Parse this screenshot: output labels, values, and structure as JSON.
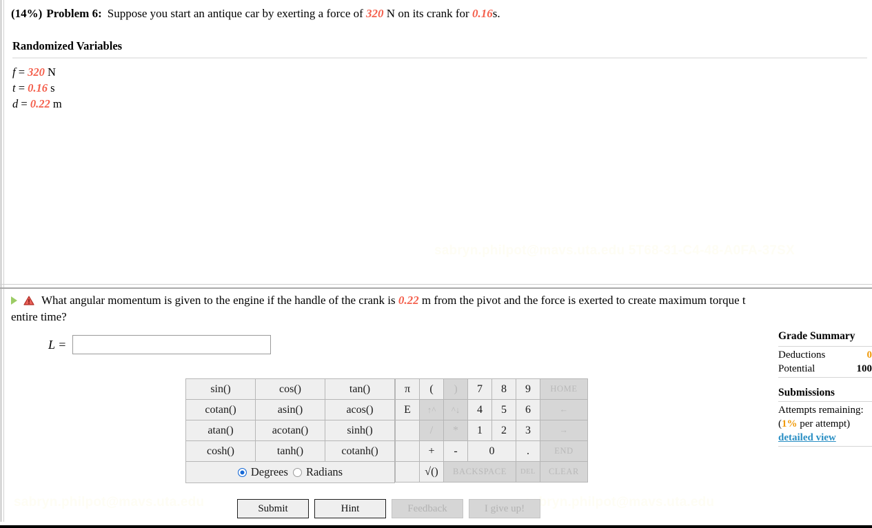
{
  "problem": {
    "percent": "(14%)",
    "number": "Problem 6:",
    "text_before_force": "Suppose you start an antique car by exerting a force of",
    "force_value": "320",
    "text_after_force": "N on its crank for",
    "time_value": "0.16",
    "text_end": "s."
  },
  "randomized_variables": {
    "title": "Randomized Variables",
    "items": [
      {
        "symbol": "f",
        "equals": "=",
        "value": "320",
        "unit": "N"
      },
      {
        "symbol": "t",
        "equals": "=",
        "value": "0.16",
        "unit": "s"
      },
      {
        "symbol": "d",
        "equals": "=",
        "value": "0.22",
        "unit": "m"
      }
    ]
  },
  "question": {
    "part1": "What angular momentum is given to the engine if the handle of the crank is",
    "distance_value": "0.22",
    "part2": "m from the pivot and the force is exerted to create maximum torque t",
    "line2": "entire time?",
    "answer_label": "L =",
    "answer_value": "",
    "answer_placeholder": ""
  },
  "calculator": {
    "trig_rows": [
      [
        "sin()",
        "cos()",
        "tan()"
      ],
      [
        "cotan()",
        "asin()",
        "acos()"
      ],
      [
        "atan()",
        "acotan()",
        "sinh()"
      ],
      [
        "cosh()",
        "tanh()",
        "cotanh()"
      ]
    ],
    "angle_mode": {
      "degrees_label": "Degrees",
      "radians_label": "Radians",
      "selected": "Degrees"
    },
    "numeric_rows": [
      [
        {
          "label": "π",
          "state": "active"
        },
        {
          "label": "(",
          "state": "active"
        },
        {
          "label": ")",
          "state": "disabled"
        },
        {
          "label": "7",
          "state": "active"
        },
        {
          "label": "8",
          "state": "active"
        },
        {
          "label": "9",
          "state": "active"
        },
        {
          "label": "HOME",
          "state": "disabled",
          "kind": "wide"
        }
      ],
      [
        {
          "label": "E",
          "state": "active"
        },
        {
          "label": "↑^",
          "state": "disabled"
        },
        {
          "label": "^↓",
          "state": "disabled"
        },
        {
          "label": "4",
          "state": "active"
        },
        {
          "label": "5",
          "state": "active"
        },
        {
          "label": "6",
          "state": "active"
        },
        {
          "label": "←",
          "state": "disabled",
          "kind": "wide"
        }
      ],
      [
        {
          "label": "",
          "state": "blank"
        },
        {
          "label": "/",
          "state": "disabled"
        },
        {
          "label": "*",
          "state": "disabled"
        },
        {
          "label": "1",
          "state": "active"
        },
        {
          "label": "2",
          "state": "active"
        },
        {
          "label": "3",
          "state": "active"
        },
        {
          "label": "→",
          "state": "disabled",
          "kind": "wide"
        }
      ],
      [
        {
          "label": "",
          "state": "blank"
        },
        {
          "label": "+",
          "state": "active"
        },
        {
          "label": "-",
          "state": "active"
        },
        {
          "label": "0",
          "state": "active",
          "span": 2
        },
        {
          "label": ".",
          "state": "active"
        },
        {
          "label": "END",
          "state": "disabled",
          "kind": "wide"
        }
      ],
      [
        {
          "label": "",
          "state": "blank"
        },
        {
          "label": "√()",
          "state": "active"
        },
        {
          "label": "BACKSPACE",
          "state": "disabled",
          "span": 3,
          "kind": "wide"
        },
        {
          "label": "DEL",
          "state": "disabled",
          "kind": "del"
        },
        {
          "label": "CLEAR",
          "state": "disabled",
          "kind": "wide"
        }
      ]
    ]
  },
  "actions": [
    {
      "label": "Submit",
      "state": "active"
    },
    {
      "label": "Hint",
      "state": "active"
    },
    {
      "label": "Feedback",
      "state": "disabled"
    },
    {
      "label": "I give up!",
      "state": "disabled"
    }
  ],
  "grade_summary": {
    "title": "Grade Summary",
    "deductions_label": "Deductions",
    "deductions_value": "0",
    "potential_label": "Potential",
    "potential_value": "100",
    "submissions_title": "Submissions",
    "attempts_label": "Attempts remaining:",
    "per_attempt_prefix": "(",
    "per_attempt_value": "1%",
    "per_attempt_suffix": " per attempt)",
    "detailed_view_label": "detailed view"
  },
  "watermark": {
    "text": "sabryn.philpot@mavs.uta.edu",
    "text_long": "sabryn.philpot@mavs.uta.edu 5T68-31-C4-48-A0FA-37SX"
  },
  "colors": {
    "variable_red": "#f4604d",
    "orange": "#f09a0a",
    "link_blue": "#2a8fc4",
    "radio_blue": "#1769d6",
    "play_green": "#9ccc65",
    "warning_red": "#d4352c"
  }
}
